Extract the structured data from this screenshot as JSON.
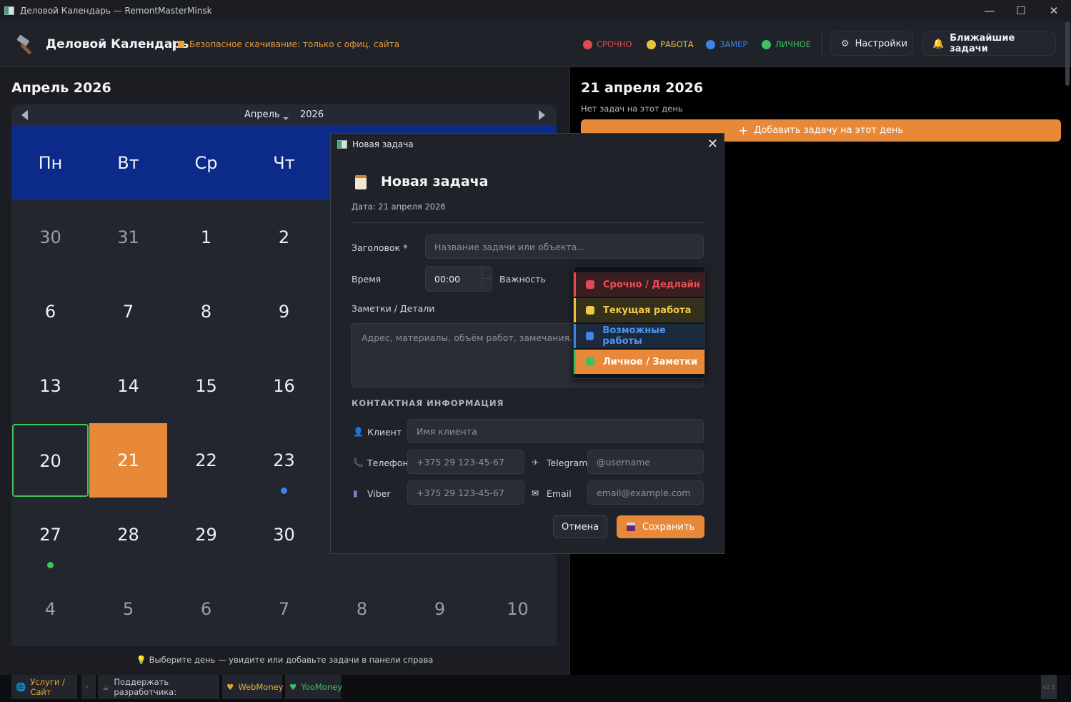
{
  "window": {
    "title": "Деловой Календарь — RemontMasterMinsk"
  },
  "header": {
    "app_name": "Деловой Календарь",
    "separator": "|",
    "secure_note": "Безопасное скачивание: только с офиц. сайта",
    "legend": [
      {
        "label": "СРОЧНО",
        "color": "#e04a55"
      },
      {
        "label": "РАБОТА",
        "color": "#e8c23a"
      },
      {
        "label": "ЗАМЕР",
        "color": "#3f83e6"
      },
      {
        "label": "ЛИЧНОЕ",
        "color": "#3ec25e"
      }
    ],
    "settings_label": "Настройки",
    "upcoming_label": "Ближайшие задачи"
  },
  "calendar": {
    "month_title": "Апрель 2026",
    "nav_month": "Апрель",
    "nav_year": "2026",
    "weekdays": [
      "Пн",
      "Вт",
      "Ср",
      "Чт"
    ],
    "days": [
      [
        "30",
        "31",
        "1",
        "2"
      ],
      [
        "6",
        "7",
        "8",
        "9"
      ],
      [
        "13",
        "14",
        "15",
        "16"
      ],
      [
        "20",
        "21",
        "22",
        "23"
      ],
      [
        "27",
        "28",
        "29",
        "30"
      ],
      [
        "4",
        "5",
        "6",
        "7",
        "8",
        "9",
        "10"
      ]
    ],
    "hint": "Выберите день — увидите или добавьте задачи в панели справа",
    "today": "20",
    "selected": "21"
  },
  "day_panel": {
    "title": "21 апреля 2026",
    "empty_text": "Нет задач на этот день",
    "add_label": "Добавить задачу на этот день"
  },
  "dialog": {
    "window_title": "Новая задача",
    "heading": "Новая задача",
    "date_line": "Дата: 21 апреля 2026",
    "title_label": "Заголовок *",
    "title_placeholder": "Название задачи или объекта...",
    "time_label": "Время",
    "time_value": "00:00",
    "priority_label": "Важность",
    "notes_label": "Заметки / Детали",
    "notes_placeholder": "Адрес, материалы, объём работ, замечания...",
    "contact_header": "КОНТАКТНАЯ ИНФОРМАЦИЯ",
    "client_label": "Клиент",
    "client_placeholder": "Имя клиента",
    "phone_label": "Телефон",
    "phone_placeholder": "+375 29 123-45-67",
    "telegram_label": "Telegram",
    "telegram_placeholder": "@username",
    "viber_label": "Viber",
    "viber_placeholder": "+375 29 123-45-67",
    "email_label": "Email",
    "email_placeholder": "email@example.com",
    "cancel_label": "Отмена",
    "save_label": "Сохранить"
  },
  "priority_options": [
    {
      "label": "Срочно / Дедлайн",
      "text_color": "#ee4f5a",
      "bg": "#3a1d20",
      "bar": "#e04a55",
      "dot": "#e04a55"
    },
    {
      "label": "Текущая работа",
      "text_color": "#f0c948",
      "bg": "#34301c",
      "bar": "#e8c23a",
      "dot": "#f0c948"
    },
    {
      "label": "Возможные работы",
      "text_color": "#4f95f0",
      "bg": "#1c2a3e",
      "bar": "#3f83e6",
      "dot": "#3f83e6"
    },
    {
      "label": "Личное / Заметки",
      "text_color": "#ffffff",
      "bg": "#e8893a",
      "bar": "#3ec25e",
      "dot": "#3ec25e"
    }
  ],
  "footer": {
    "services_label": "Услуги / Сайт",
    "dot_label": "·",
    "support_label": "Поддержать разработчика:",
    "webmoney_label": "WebMoney",
    "yoomoney_label": "YooMoney",
    "version_label": "v2.1"
  }
}
